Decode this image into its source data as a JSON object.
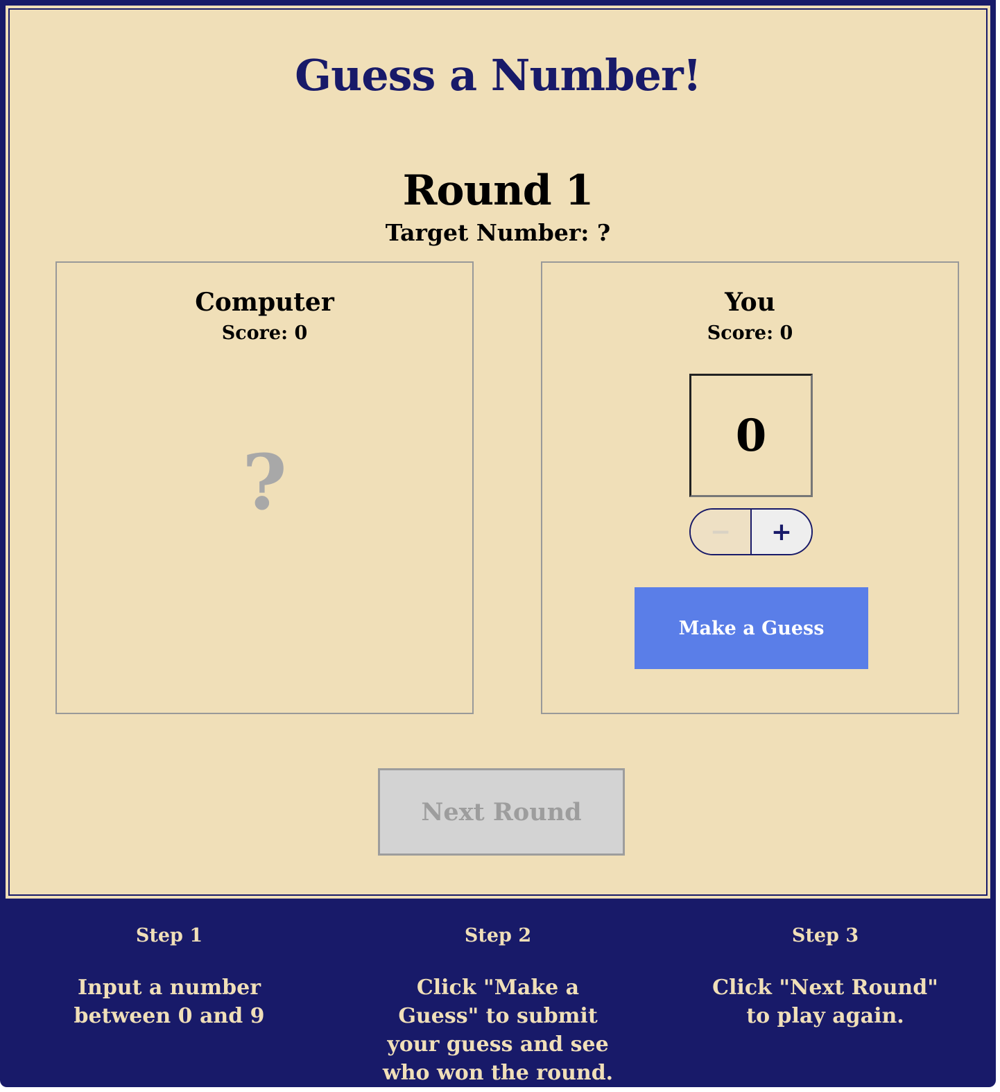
{
  "header": {
    "title": "Guess a Number!"
  },
  "round": {
    "title": "Round 1",
    "target_label": "Target Number: ?"
  },
  "computer": {
    "name": "Computer",
    "score_label": "Score: 0",
    "guess": "?"
  },
  "player": {
    "name": "You",
    "score_label": "Score: 0",
    "guess_value": "0",
    "decrement_label": "−",
    "increment_label": "+",
    "guess_button_label": "Make a Guess"
  },
  "next_round_label": "Next Round",
  "steps": [
    {
      "heading": "Step 1",
      "text": "Input a number between 0 and 9"
    },
    {
      "heading": "Step 2",
      "text": "Click \"Make a Guess\" to submit your guess and see who won the round."
    },
    {
      "heading": "Step 3",
      "text": "Click \"Next Round\" to play again."
    }
  ],
  "colors": {
    "brand_navy": "#181a69",
    "background_tan": "#f0dfb8",
    "guess_button_blue": "#5a7ee8",
    "disabled_gray": "#d3d3d3"
  }
}
